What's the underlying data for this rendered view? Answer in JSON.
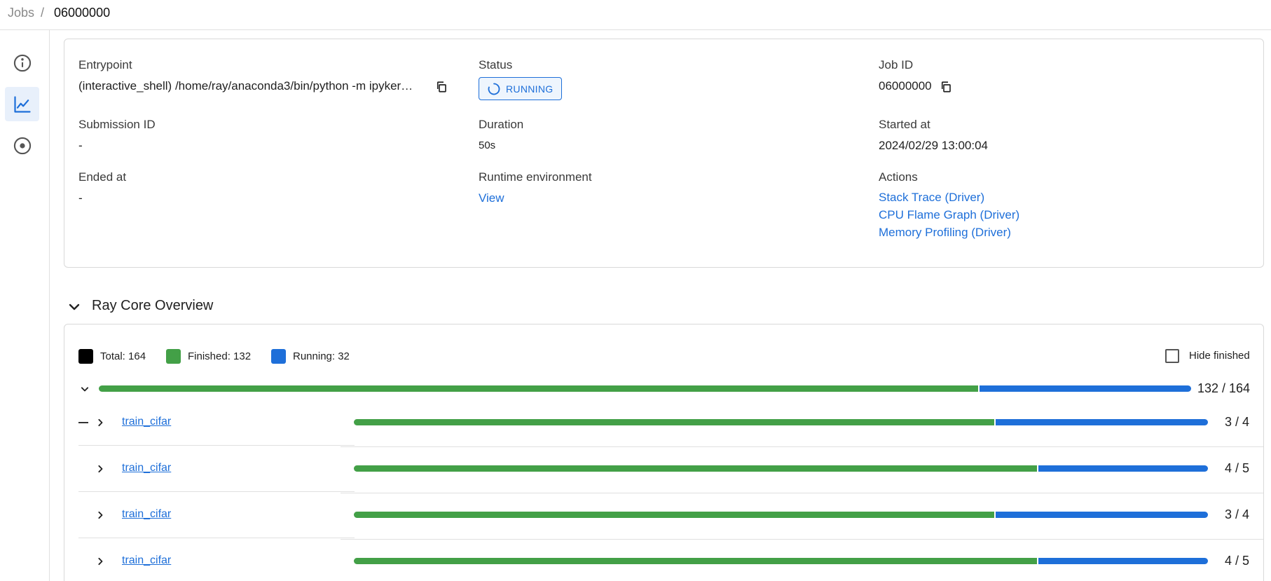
{
  "breadcrumb": {
    "root": "Jobs",
    "separator": "/",
    "current": "06000000"
  },
  "sidebar": [
    {
      "icon": "info-icon",
      "active": false
    },
    {
      "icon": "chart-icon",
      "active": true
    },
    {
      "icon": "radar-icon",
      "active": false
    }
  ],
  "job": {
    "entrypoint_label": "Entrypoint",
    "entrypoint_value": "(interactive_shell) /home/ray/anaconda3/bin/python -m ipyker…",
    "status_label": "Status",
    "status_value": "RUNNING",
    "job_id_label": "Job ID",
    "job_id_value": "06000000",
    "submission_label": "Submission ID",
    "submission_value": "-",
    "duration_label": "Duration",
    "duration_value": "50s",
    "started_label": "Started at",
    "started_value": "2024/02/29 13:00:04",
    "ended_label": "Ended at",
    "ended_value": "-",
    "runtime_label": "Runtime environment",
    "runtime_link": "View",
    "actions_label": "Actions",
    "actions": [
      "Stack Trace (Driver)",
      "CPU Flame Graph (Driver)",
      "Memory Profiling (Driver)"
    ]
  },
  "overview": {
    "title": "Ray Core Overview",
    "legend": {
      "total": "Total: 164",
      "finished": "Finished: 132",
      "running": "Running: 32"
    },
    "hide_finished_label": "Hide finished",
    "hide_finished_checked": false,
    "summary": {
      "finished": 132,
      "total": 164,
      "count": "132 / 164"
    },
    "rows": [
      {
        "name": "train_cifar",
        "finished": 3,
        "total": 4,
        "count": "3 / 4"
      },
      {
        "name": "train_cifar",
        "finished": 4,
        "total": 5,
        "count": "4 / 5"
      },
      {
        "name": "train_cifar",
        "finished": 3,
        "total": 4,
        "count": "3 / 4"
      },
      {
        "name": "train_cifar",
        "finished": 4,
        "total": 5,
        "count": "4 / 5"
      }
    ]
  },
  "colors": {
    "accent": "#1e6fd9",
    "finished": "#43a047",
    "running": "#1e6fd9",
    "total": "#000000"
  }
}
